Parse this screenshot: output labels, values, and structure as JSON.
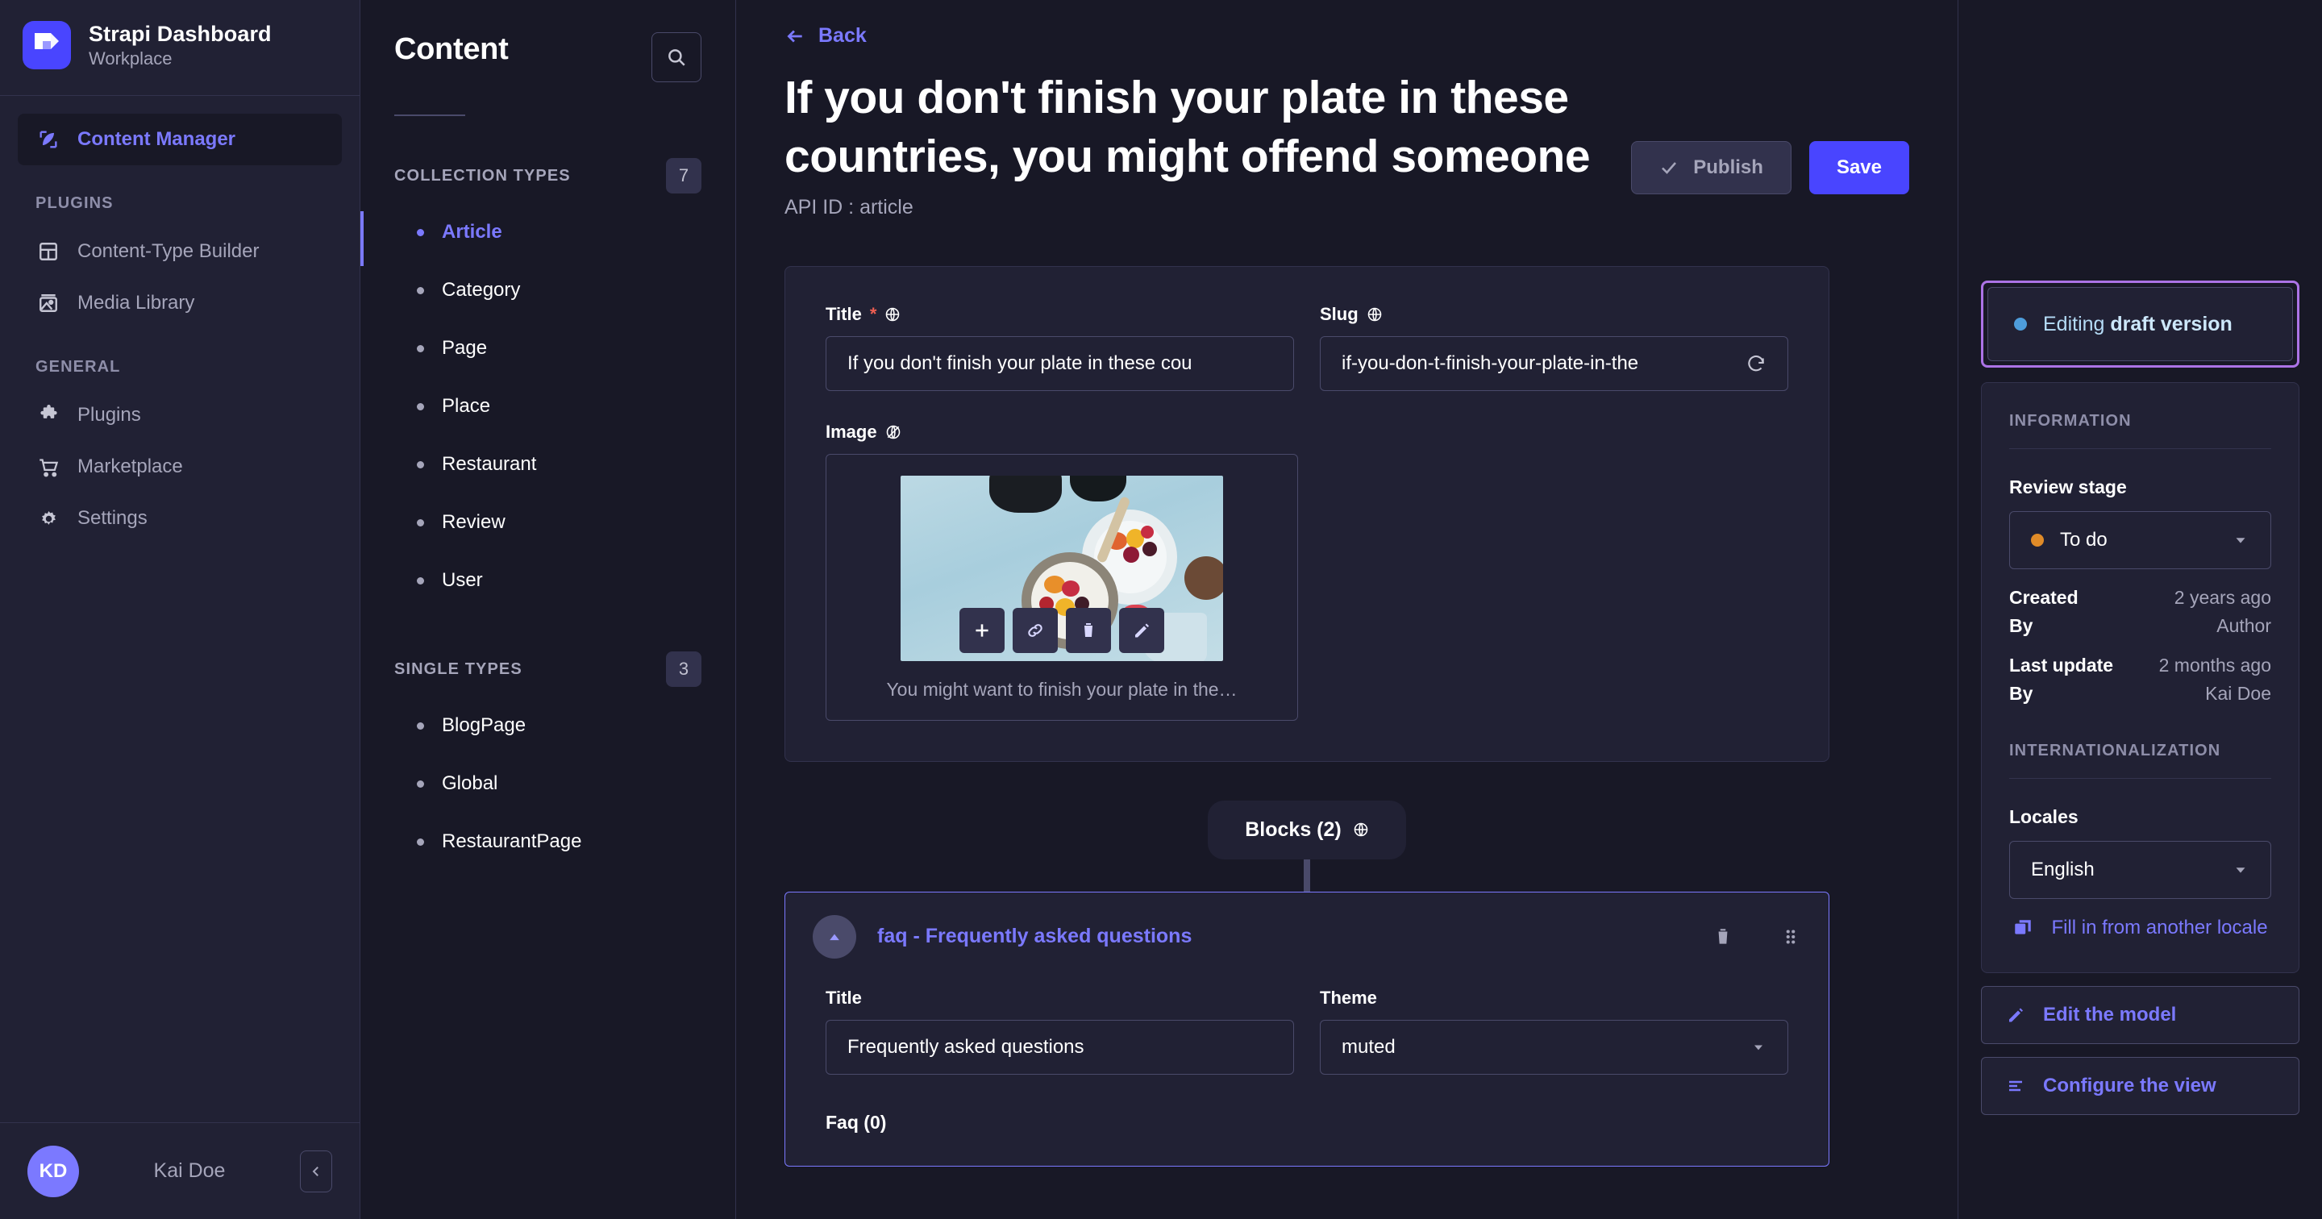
{
  "brand": {
    "title": "Strapi Dashboard",
    "subtitle": "Workplace",
    "logo_icon": "strapi-logo-icon",
    "accent": "#4945ff"
  },
  "sidebar": {
    "primary": {
      "label": "Content Manager",
      "icon": "feather-pen-icon"
    },
    "sections": [
      {
        "label": "PLUGINS",
        "items": [
          {
            "label": "Content-Type Builder",
            "icon": "layout-grid-icon"
          },
          {
            "label": "Media Library",
            "icon": "image-icon"
          }
        ]
      },
      {
        "label": "GENERAL",
        "items": [
          {
            "label": "Plugins",
            "icon": "puzzle-icon"
          },
          {
            "label": "Marketplace",
            "icon": "shopping-cart-icon"
          },
          {
            "label": "Settings",
            "icon": "gear-icon"
          }
        ]
      }
    ],
    "footer": {
      "initials": "KD",
      "name": "Kai Doe",
      "collapse_icon": "chevron-left-icon"
    }
  },
  "content_panel": {
    "title": "Content",
    "search_icon": "search-icon",
    "groups": [
      {
        "label": "COLLECTION TYPES",
        "count": "7",
        "items": [
          {
            "label": "Article",
            "active": true
          },
          {
            "label": "Category",
            "active": false
          },
          {
            "label": "Page",
            "active": false
          },
          {
            "label": "Place",
            "active": false
          },
          {
            "label": "Restaurant",
            "active": false
          },
          {
            "label": "Review",
            "active": false
          },
          {
            "label": "User",
            "active": false
          }
        ]
      },
      {
        "label": "SINGLE TYPES",
        "count": "3",
        "items": [
          {
            "label": "BlogPage",
            "active": false
          },
          {
            "label": "Global",
            "active": false
          },
          {
            "label": "RestaurantPage",
            "active": false
          }
        ]
      }
    ]
  },
  "header": {
    "back_label": "Back",
    "back_icon": "arrow-left-icon",
    "doc_title": "If you don't finish your plate in these countries, you might offend someone",
    "api_id": "API ID : article",
    "publish_label": "Publish",
    "publish_icon": "check-icon",
    "save_label": "Save"
  },
  "form": {
    "title_field": {
      "label": "Title",
      "required_mark": "*",
      "i18n_icon": "globe-icon",
      "value": "If you don't finish your plate in these cou"
    },
    "slug_field": {
      "label": "Slug",
      "i18n_icon": "globe-icon",
      "value": "if-you-don-t-finish-your-plate-in-the",
      "regenerate_icon": "refresh-icon"
    },
    "image_field": {
      "label": "Image",
      "i18n_off_icon": "globe-crossed-icon",
      "caption": "You might want to finish your plate in the…",
      "actions": [
        {
          "name": "add-icon",
          "glyph": "+"
        },
        {
          "name": "link-icon",
          "glyph": "link"
        },
        {
          "name": "trash-icon",
          "glyph": "trash"
        },
        {
          "name": "pencil-icon",
          "glyph": "pencil"
        }
      ]
    }
  },
  "blocks": {
    "pill_label": "Blocks (2)",
    "pill_icon": "globe-icon",
    "component": {
      "name": "faq - Frequently asked questions",
      "collapse_icon": "chevron-up-icon",
      "delete_icon": "trash-icon",
      "drag_icon": "drag-handle-icon",
      "fields": {
        "title": {
          "label": "Title",
          "value": "Frequently asked questions"
        },
        "theme": {
          "label": "Theme",
          "value": "muted",
          "chevron_icon": "chevron-down-icon"
        }
      },
      "repeatable_label": "Faq (0)"
    }
  },
  "right_panel": {
    "draft_status": {
      "prefix": "Editing ",
      "emphasis": "draft version",
      "dot_color": "#4e9ddb",
      "highlight_color": "#ac73e6"
    },
    "information": {
      "section_label": "INFORMATION",
      "review_stage_label": "Review stage",
      "review_stage_value": "To do",
      "review_stage_dot_color": "#e08b28",
      "chevron_icon": "chevron-down-icon",
      "meta": [
        {
          "key": "Created",
          "value": "2 years ago"
        },
        {
          "key": "By",
          "value": "Author"
        },
        {
          "key": "Last update",
          "value": "2 months ago"
        },
        {
          "key": "By",
          "value": "Kai Doe"
        }
      ]
    },
    "internationalization": {
      "section_label": "INTERNATIONALIZATION",
      "locales_label": "Locales",
      "locale_value": "English",
      "chevron_icon": "chevron-down-icon",
      "fill_locale_label": "Fill in from another locale",
      "fill_locale_icon": "copy-icon"
    },
    "actions": [
      {
        "label": "Edit the model",
        "icon": "pencil-icon"
      },
      {
        "label": "Configure the view",
        "icon": "sliders-icon"
      }
    ]
  }
}
